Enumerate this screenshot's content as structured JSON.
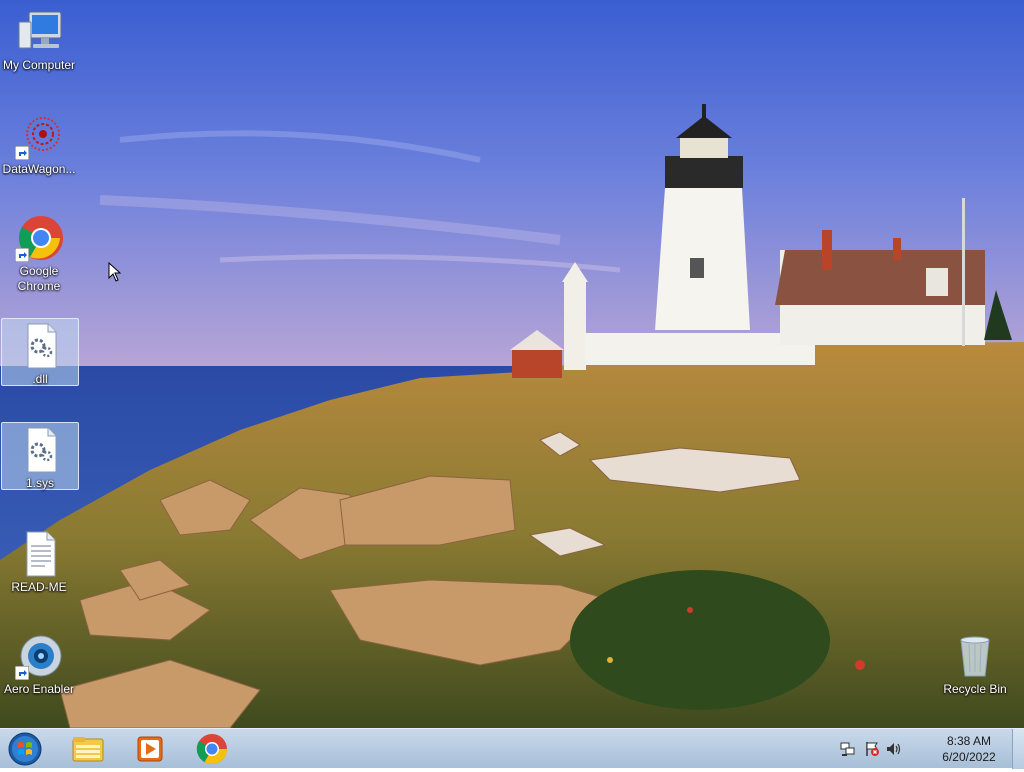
{
  "desktop": {
    "icons": [
      {
        "label": "My Computer"
      },
      {
        "label": "DataWagon..."
      },
      {
        "label": "Google Chrome"
      },
      {
        "label": ".dll"
      },
      {
        "label": "1.sys"
      },
      {
        "label": "READ-ME"
      },
      {
        "label": "Aero Enabler"
      },
      {
        "label": "Recycle Bin"
      }
    ]
  },
  "taskbar": {
    "start_icon": "windows-start-orb",
    "pinned": [
      {
        "icon": "windows-explorer-icon"
      },
      {
        "icon": "media-player-icon"
      },
      {
        "icon": "chrome-icon"
      }
    ],
    "tray": {
      "icons": [
        "network-icon",
        "action-center-flag-icon",
        "volume-icon"
      ],
      "time": "8:38 AM",
      "date": "6/20/2022"
    }
  },
  "colors": {
    "taskbar_top": "#c9d9ea",
    "taskbar_bottom": "#a7bfd8",
    "sky_top": "#3a5ed1",
    "sea": "#2d4fa8"
  }
}
